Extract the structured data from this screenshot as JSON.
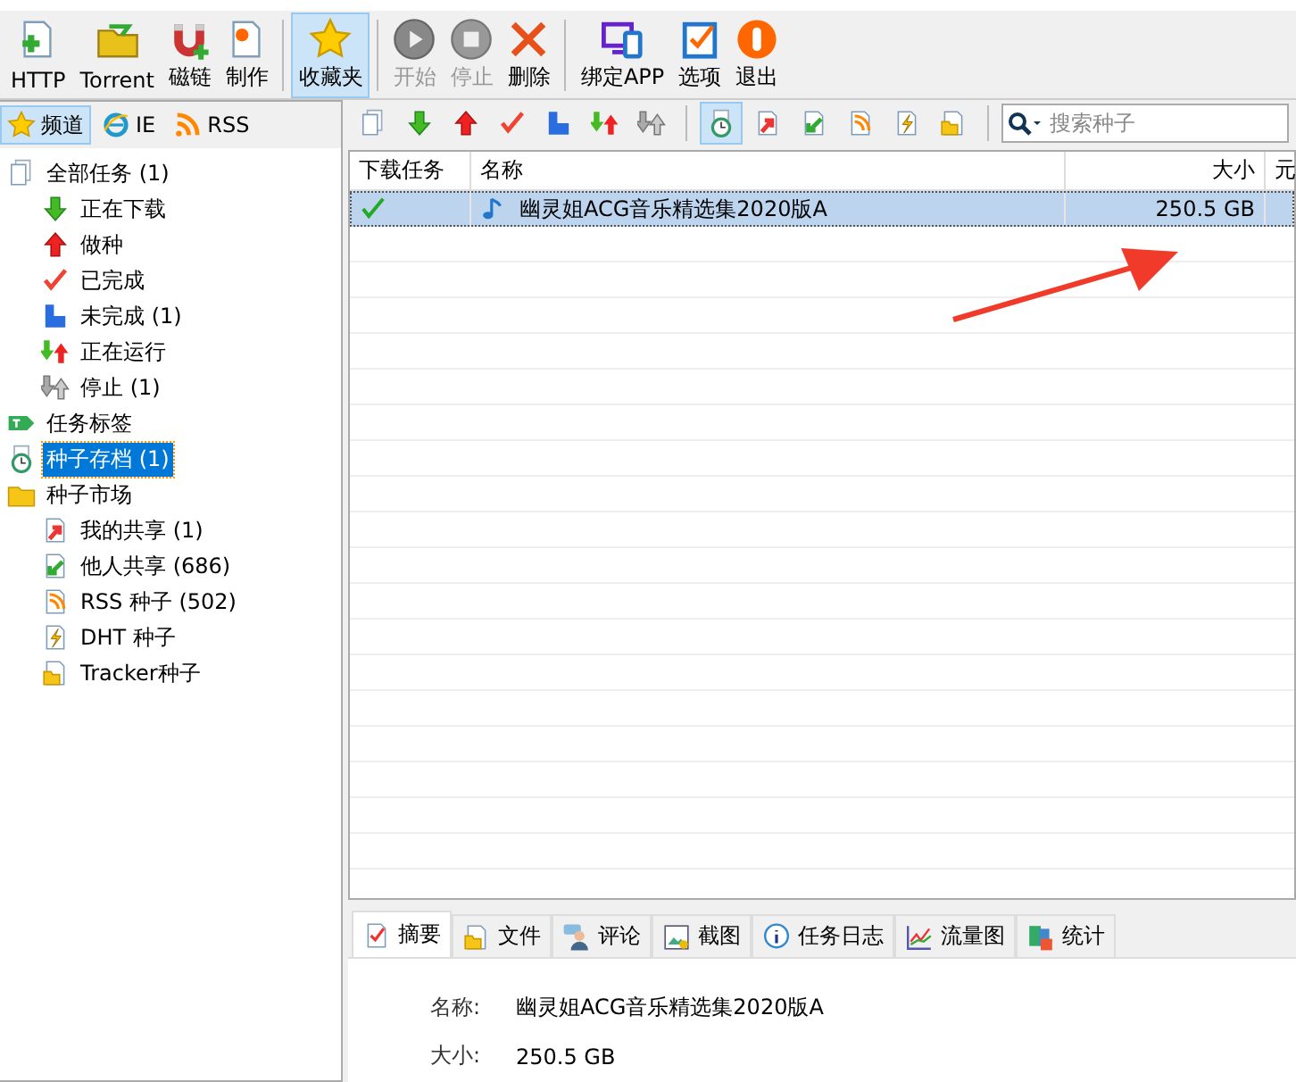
{
  "toolbar": [
    {
      "label": "HTTP",
      "kind": "page-plus",
      "selected": false,
      "disabled": false
    },
    {
      "label": "Torrent",
      "kind": "folder-arrow",
      "selected": false,
      "disabled": false
    },
    {
      "label": "磁链",
      "kind": "magnet",
      "selected": false,
      "disabled": false
    },
    {
      "label": "制作",
      "kind": "page-gear",
      "selected": false,
      "disabled": false,
      "sep": true
    },
    {
      "label": "收藏夹",
      "kind": "star",
      "selected": true,
      "disabled": false,
      "sep": true
    },
    {
      "label": "开始",
      "kind": "play",
      "selected": false,
      "disabled": true
    },
    {
      "label": "停止",
      "kind": "stop",
      "selected": false,
      "disabled": true
    },
    {
      "label": "删除",
      "kind": "cross",
      "selected": false,
      "disabled": false,
      "sep": true
    },
    {
      "label": "绑定APP",
      "kind": "devices",
      "selected": false,
      "disabled": false
    },
    {
      "label": "选项",
      "kind": "checklist",
      "selected": false,
      "disabled": false
    },
    {
      "label": "退出",
      "kind": "power",
      "selected": false,
      "disabled": false
    }
  ],
  "sidebar": {
    "tabs": [
      {
        "label": "频道",
        "kind": "star",
        "selected": true
      },
      {
        "label": "IE",
        "kind": "ie",
        "selected": false
      },
      {
        "label": "RSS",
        "kind": "rss",
        "selected": false
      }
    ],
    "tree": [
      {
        "label": "全部任务 (1)",
        "kind": "pages",
        "selected": false,
        "children": [
          {
            "label": "正在下载",
            "kind": "down",
            "selected": false
          },
          {
            "label": "做种",
            "kind": "up",
            "selected": false
          },
          {
            "label": "已完成",
            "kind": "check",
            "selected": false
          },
          {
            "label": "未完成 (1)",
            "kind": "partial",
            "selected": false
          },
          {
            "label": "正在运行",
            "kind": "updown",
            "selected": false
          },
          {
            "label": "停止 (1)",
            "kind": "updown-gray",
            "selected": false
          }
        ]
      },
      {
        "label": "任务标签",
        "kind": "tag",
        "selected": false
      },
      {
        "label": "种子存档 (1)",
        "kind": "clock",
        "selected": true
      },
      {
        "label": "种子市场",
        "kind": "folder",
        "selected": false,
        "children": [
          {
            "label": "我的共享 (1)",
            "kind": "page-up",
            "selected": false
          },
          {
            "label": "他人共享 (686)",
            "kind": "page-down",
            "selected": false
          },
          {
            "label": "RSS 种子 (502)",
            "kind": "page-rss",
            "selected": false
          },
          {
            "label": "DHT 种子",
            "kind": "page-bolt",
            "selected": false
          },
          {
            "label": "Tracker种子",
            "kind": "page-folder",
            "selected": false
          }
        ]
      }
    ]
  },
  "filter_toolbar": {
    "buttons": [
      {
        "kind": "pages",
        "selected": false
      },
      {
        "kind": "down",
        "selected": false
      },
      {
        "kind": "up",
        "selected": false
      },
      {
        "kind": "check",
        "selected": false
      },
      {
        "kind": "partial",
        "selected": false
      },
      {
        "kind": "updown",
        "selected": false
      },
      {
        "kind": "updown-gray",
        "selected": false,
        "sep": true
      },
      {
        "kind": "clock",
        "selected": true
      },
      {
        "kind": "page-up",
        "selected": false
      },
      {
        "kind": "page-down",
        "selected": false
      },
      {
        "kind": "page-rss",
        "selected": false
      },
      {
        "kind": "page-bolt",
        "selected": false
      },
      {
        "kind": "page-folder",
        "selected": false
      }
    ],
    "search": {
      "placeholder": "搜索种子"
    }
  },
  "table": {
    "columns": [
      "下载任务",
      "名称",
      "大小",
      "元"
    ],
    "rows": [
      {
        "done": true,
        "name": "幽灵姐ACG音乐精选集2020版A",
        "size": "250.5 GB",
        "selected": true
      }
    ]
  },
  "detail_tabs": [
    {
      "label": "摘要",
      "kind": "check-page",
      "selected": true
    },
    {
      "label": "文件",
      "kind": "page-folder",
      "selected": false
    },
    {
      "label": "评论",
      "kind": "person",
      "selected": false
    },
    {
      "label": "截图",
      "kind": "picture",
      "selected": false
    },
    {
      "label": "任务日志",
      "kind": "info",
      "selected": false
    },
    {
      "label": "流量图",
      "kind": "chart",
      "selected": false
    },
    {
      "label": "统计",
      "kind": "blocks",
      "selected": false
    }
  ],
  "details": [
    {
      "label": "名称:",
      "value": "幽灵姐ACG音乐精选集2020版A"
    },
    {
      "label": "大小:",
      "value": "250.5 GB"
    }
  ]
}
